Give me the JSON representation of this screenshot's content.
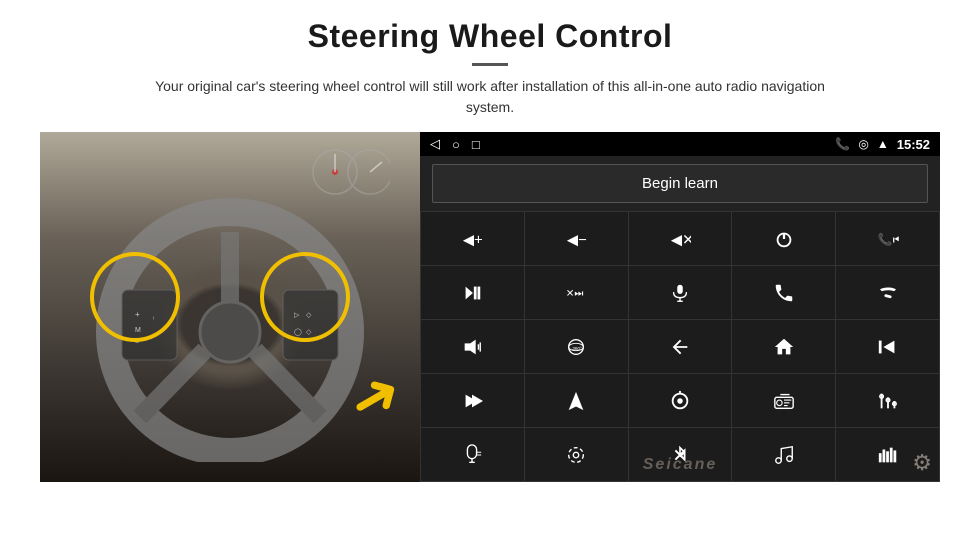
{
  "header": {
    "title": "Steering Wheel Control",
    "subtitle": "Your original car's steering wheel control will still work after installation of this all-in-one auto radio navigation system."
  },
  "status_bar": {
    "time": "15:52",
    "icons": [
      "◁",
      "○",
      "□"
    ]
  },
  "begin_learn_button": "Begin learn",
  "watermark": "Seicane",
  "controls": [
    {
      "icon": "vol_up",
      "label": "Volume Up"
    },
    {
      "icon": "vol_down",
      "label": "Volume Down"
    },
    {
      "icon": "mute",
      "label": "Mute"
    },
    {
      "icon": "power",
      "label": "Power"
    },
    {
      "icon": "prev_track",
      "label": "Previous Track"
    },
    {
      "icon": "skip_next",
      "label": "Skip Next"
    },
    {
      "icon": "fast_forward",
      "label": "Fast Forward"
    },
    {
      "icon": "mic",
      "label": "Microphone"
    },
    {
      "icon": "phone",
      "label": "Phone"
    },
    {
      "icon": "hang_up",
      "label": "Hang Up"
    },
    {
      "icon": "horn",
      "label": "Horn"
    },
    {
      "icon": "surround",
      "label": "360 View"
    },
    {
      "icon": "back",
      "label": "Back"
    },
    {
      "icon": "home",
      "label": "Home"
    },
    {
      "icon": "rewind",
      "label": "Rewind"
    },
    {
      "icon": "skip_next2",
      "label": "Next"
    },
    {
      "icon": "nav",
      "label": "Navigation"
    },
    {
      "icon": "source",
      "label": "Source"
    },
    {
      "icon": "radio",
      "label": "Radio"
    },
    {
      "icon": "eq",
      "label": "Equalizer"
    },
    {
      "icon": "mic2",
      "label": "Voice"
    },
    {
      "icon": "settings2",
      "label": "Settings"
    },
    {
      "icon": "bt",
      "label": "Bluetooth"
    },
    {
      "icon": "music",
      "label": "Music"
    },
    {
      "icon": "spectrum",
      "label": "Spectrum"
    }
  ]
}
